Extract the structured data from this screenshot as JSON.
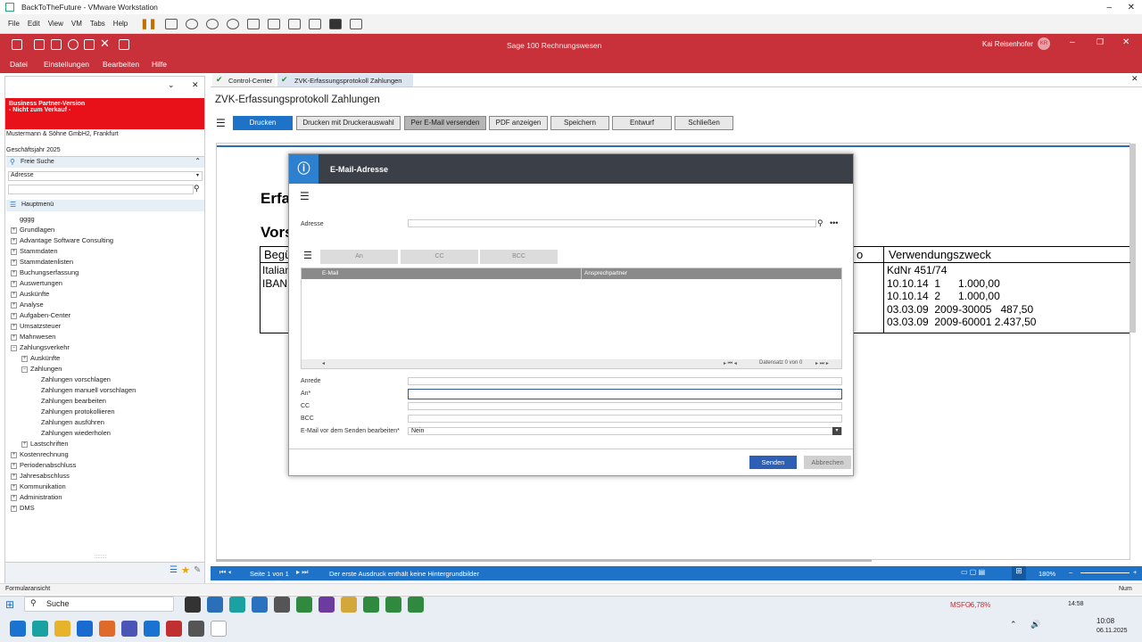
{
  "vm": {
    "title": "BackToTheFuture - VMware Workstation",
    "menu": [
      "File",
      "Edit",
      "View",
      "VM",
      "Tabs",
      "Help"
    ]
  },
  "sage": {
    "app_title": "Sage 100 Rechnungswesen",
    "user": "Kai Reisenhofer",
    "user_initials": "KR",
    "menu": [
      "Datei",
      "Einstellungen",
      "Bearbeiten",
      "Hilfe"
    ]
  },
  "left": {
    "banner_line1": "Business Partner-Version",
    "banner_line2": "- Nicht zum Verkauf -",
    "company": "Mustermann & Söhne GmbH2, Frankfurt",
    "fiscal_year": "Geschäftsjahr 2025",
    "search_label": "Freie Suche",
    "search_select": "Adresse",
    "menu_header": "Hauptmenü",
    "tree": [
      "gggg",
      "Grundlagen",
      "Advantage Software Consulting",
      "Stammdaten",
      "Stammdatenlisten",
      "Buchungserfassung",
      "Auswertungen",
      "Auskünfte",
      "Analyse",
      "Aufgaben-Center",
      "Umsatzsteuer",
      "Mahnwesen",
      "Zahlungsverkehr",
      "Auskünfte",
      "Zahlungen",
      "Zahlungen vorschlagen",
      "Zahlungen manuell vorschlagen",
      "Zahlungen bearbeiten",
      "Zahlungen protokollieren",
      "Zahlungen ausführen",
      "Zahlungen wiederholen",
      "Lastschriften",
      "Kostenrechnung",
      "Periodenabschluss",
      "Jahresabschluss",
      "Kommunikation",
      "Administration",
      "DMS"
    ]
  },
  "tabs": {
    "tab1": "Control-Center",
    "tab2": "ZVK-Erfassungsprotokoll Zahlungen"
  },
  "doc": {
    "title": "ZVK-Erfassungsprotokoll Zahlungen",
    "buttons": [
      "Drucken",
      "Drucken mit Druckerauswahl",
      "Per E-Mail versenden",
      "PDF anzeigen",
      "Speichern",
      "Entwurf",
      "Schließen"
    ],
    "report_heading1": "Erfa",
    "report_heading2": "Vors",
    "col_beg": "Begü",
    "col_o": "o",
    "col_vz": "Verwendungszweck",
    "beg1": "Italian",
    "beg2": "IBAN",
    "vz_rows": [
      "KdNr 451/74",
      "10.10.14  1      1.000,00",
      "10.10.14  2      1.000,00",
      "03.03.09  2009-30005   487,50",
      "03.03.09  2009-60001 2.437,50"
    ]
  },
  "dialog": {
    "title": "E-Mail-Adresse",
    "address_label": "Adresse",
    "tab_an": "An",
    "tab_cc": "CC",
    "tab_bcc": "BCC",
    "col_email": "E-Mail",
    "col_contact": "Ansprechpartner",
    "record_info": "Datensatz 0 von 0",
    "lbl_anrede": "Anrede",
    "lbl_an": "An*",
    "lbl_cc": "CC",
    "lbl_bcc": "BCC",
    "lbl_edit": "E-Mail vor dem Senden bearbeiten*",
    "edit_value": "Nein",
    "send": "Senden",
    "cancel": "Abbrechen"
  },
  "status": {
    "page": "Seite 1 von 1",
    "hint": "Der erste Ausdruck enthält keine Hintergrundbilder",
    "zoom": "180%",
    "form_view": "Formularansicht",
    "num": "Num"
  },
  "taskbar": {
    "search": "Suche",
    "stock_name": "MSFO",
    "stock_change": "-6,78%",
    "time": "10:08",
    "date": "06.11.2025",
    "tray_time": "14:58"
  },
  "colors": {
    "sage_red": "#c8303a",
    "dialog_header": "#3a3f48",
    "blue": "#1e73c8"
  }
}
